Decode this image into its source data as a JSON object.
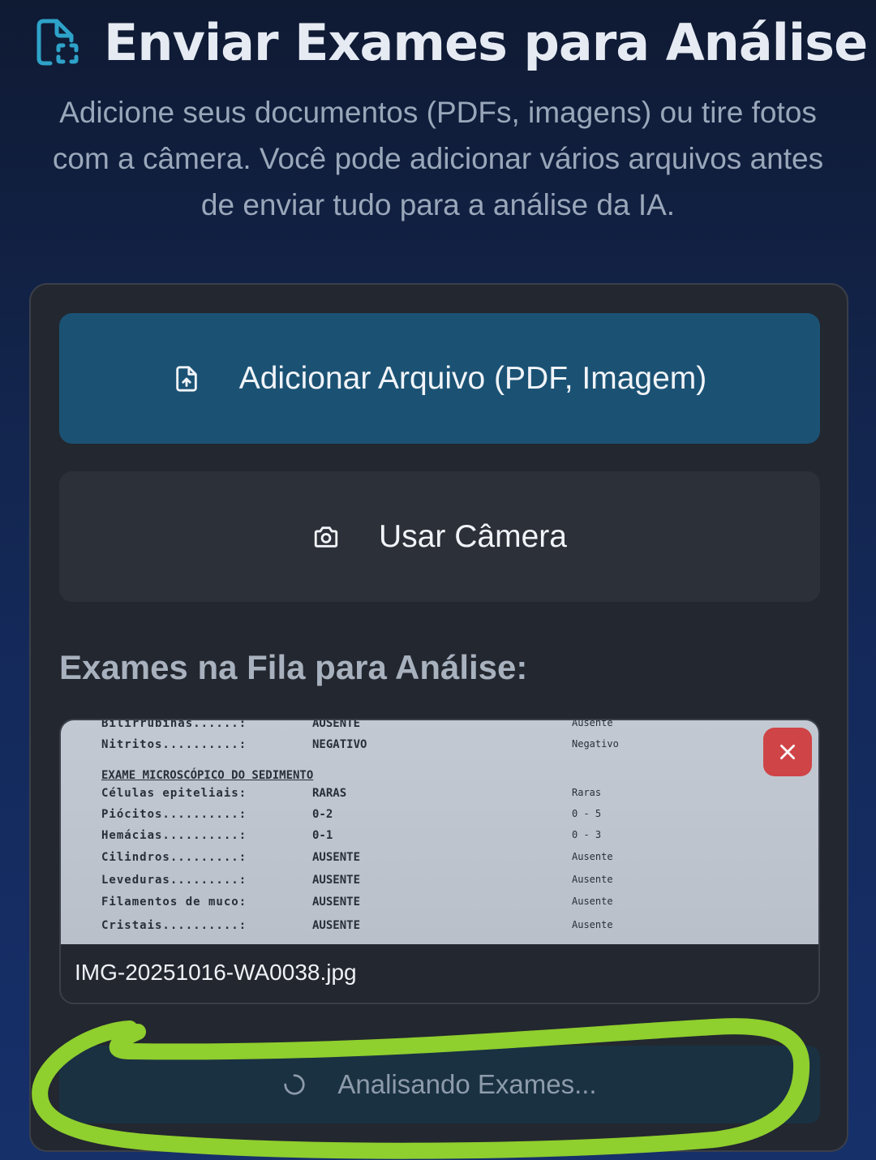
{
  "header": {
    "title": "Enviar Exames para Análise",
    "subtitle": "Adicione seus documentos (PDFs, imagens) ou tire fotos com a câmera. Você pode adicionar vários arquivos antes de enviar tudo para a análise da IA.",
    "icon": "file-scan-icon"
  },
  "actions": {
    "add_file_label": "Adicionar Arquivo (PDF, Imagem)",
    "add_file_icon": "file-upload-icon",
    "camera_label": "Usar Câmera",
    "camera_icon": "camera-icon"
  },
  "queue": {
    "title": "Exames na Fila para Análise:",
    "items": [
      {
        "file_name": "IMG-20251016-WA0038.jpg",
        "preview": {
          "rows_top": [
            {
              "label": "Bilirrubinas......:",
              "value": "AUSENTE",
              "ref": "Ausente"
            },
            {
              "label": "Nitritos..........:",
              "value": "NEGATIVO",
              "ref": "Negativo"
            }
          ],
          "section": "EXAME MICROSCÓPICO DO SEDIMENTO",
          "rows": [
            {
              "label": "Células epiteliais:",
              "value": "RARAS",
              "ref": "Raras"
            },
            {
              "label": "Piócitos..........:",
              "value": "0-2",
              "ref": "0 - 5"
            },
            {
              "label": "Hemácias..........:",
              "value": "0-1",
              "ref": "0 - 3"
            },
            {
              "label": "Cilindros.........:",
              "value": "AUSENTE",
              "ref": "Ausente"
            },
            {
              "label": "Leveduras.........:",
              "value": "AUSENTE",
              "ref": "Ausente"
            },
            {
              "label": "Filamentos de muco:",
              "value": "AUSENTE",
              "ref": "Ausente"
            },
            {
              "label": "Cristais..........:",
              "value": "AUSENTE",
              "ref": "Ausente"
            }
          ]
        }
      }
    ]
  },
  "submit": {
    "label": "Analisando Exames...",
    "icon": "spinner-icon"
  },
  "colors": {
    "accent": "#1b5274",
    "danger": "#cf4446",
    "highlight": "#8fcf2e"
  }
}
